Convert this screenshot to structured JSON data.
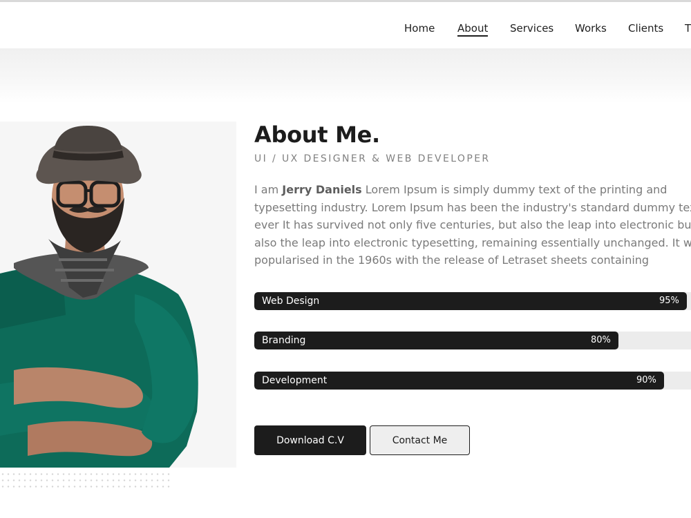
{
  "nav": {
    "items": [
      {
        "label": "Home",
        "active": false
      },
      {
        "label": "About",
        "active": true
      },
      {
        "label": "Services",
        "active": false
      },
      {
        "label": "Works",
        "active": false
      },
      {
        "label": "Clients",
        "active": false
      },
      {
        "label": "T",
        "active": false
      }
    ]
  },
  "about": {
    "heading": "About Me.",
    "subtitle": "UI / UX DESIGNER & WEB DEVELOPER",
    "intro_prefix": "I am ",
    "name": "Jerry Daniels",
    "intro_line1_rest": " Lorem Ipsum is simply dummy text of the printing and",
    "intro_line2": "typesetting industry. Lorem Ipsum has been the industry's standard dummy tex",
    "intro_line3": "ever It has survived not only five centuries, but also the leap into electronic but",
    "intro_line4": "also the leap into electronic typesetting, remaining essentially unchanged. It wa",
    "intro_line5": "popularised in the 1960s with the release of Letraset sheets containing"
  },
  "skills": [
    {
      "label": "Web Design",
      "percent_text": "95%",
      "value": 95
    },
    {
      "label": "Branding",
      "percent_text": "80%",
      "value": 80
    },
    {
      "label": "Development",
      "percent_text": "90%",
      "value": 90
    }
  ],
  "buttons": {
    "download": "Download C.V",
    "contact": "Contact Me"
  },
  "colors": {
    "accent": "#1c1c1c",
    "sweater": "#0d6b59",
    "track": "#ececec"
  }
}
